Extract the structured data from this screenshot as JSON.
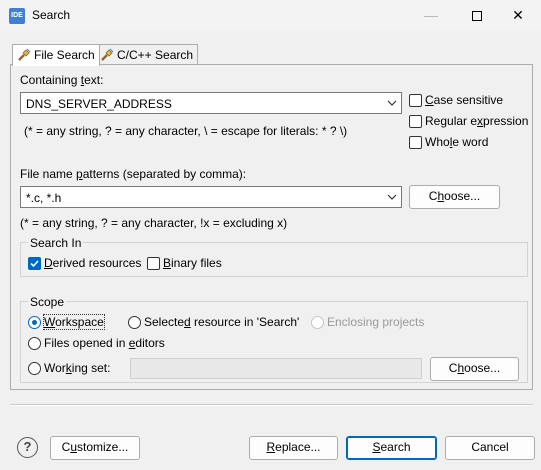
{
  "window": {
    "app_icon_text": "IDE",
    "title": "Search"
  },
  "tabs": [
    {
      "label": "File Search",
      "icon": "flashlight-icon",
      "active": true
    },
    {
      "label": "C/C++ Search",
      "icon": "flashlight-icon",
      "active": false
    }
  ],
  "containing_text": {
    "label_prefix": "Containing ",
    "label_mnemonic": "t",
    "label_suffix": "ext:",
    "value": "DNS_SERVER_ADDRESS",
    "hint": "(* = any string, ? = any character, \\ = escape for literals: * ? \\)"
  },
  "options": {
    "case_sensitive": {
      "mnemonic": "C",
      "rest": "ase sensitive",
      "checked": false
    },
    "regex": {
      "prefix": "Regular e",
      "mnemonic": "x",
      "rest": "pression",
      "checked": false
    },
    "whole_word": {
      "prefix": "Who",
      "mnemonic": "l",
      "rest": "e word",
      "checked": false
    }
  },
  "file_patterns": {
    "label_prefix": "File name ",
    "label_mnemonic": "p",
    "label_suffix": "atterns (separated by comma):",
    "value": "*.c, *.h",
    "hint": "(* = any string, ? = any character, !x = excluding x)",
    "choose_prefix": "C",
    "choose_mnemonic": "h",
    "choose_suffix": "oose..."
  },
  "search_in": {
    "title": "Search In",
    "derived": {
      "mnemonic": "D",
      "rest": "erived resources",
      "checked": true
    },
    "binary": {
      "mnemonic": "B",
      "rest": "inary files",
      "checked": false
    }
  },
  "scope": {
    "title": "Scope",
    "workspace": {
      "mnemonic": "W",
      "rest": "orkspace",
      "checked": true
    },
    "selected_resource": {
      "prefix": "Selecte",
      "mnemonic": "d",
      "rest": " resource in 'Search'",
      "checked": false
    },
    "enclosing_projects": {
      "label": "Enclosing projects",
      "enabled": false
    },
    "files_opened": {
      "prefix": "Files opened in ",
      "mnemonic": "e",
      "rest": "ditors",
      "checked": false
    },
    "working_set": {
      "prefix": "Wor",
      "mnemonic": "k",
      "rest": "ing set:",
      "value": "",
      "checked": false
    },
    "choose_prefix": "C",
    "choose_mnemonic": "h",
    "choose_suffix": "oose..."
  },
  "footer": {
    "help_icon": "help-icon",
    "customize_prefix": "C",
    "customize_mnemonic": "u",
    "customize_suffix": "stomize...",
    "replace_prefix": "",
    "replace_mnemonic": "R",
    "replace_suffix": "eplace...",
    "search_prefix": "",
    "search_mnemonic": "S",
    "search_suffix": "earch",
    "cancel_label": "Cancel"
  }
}
